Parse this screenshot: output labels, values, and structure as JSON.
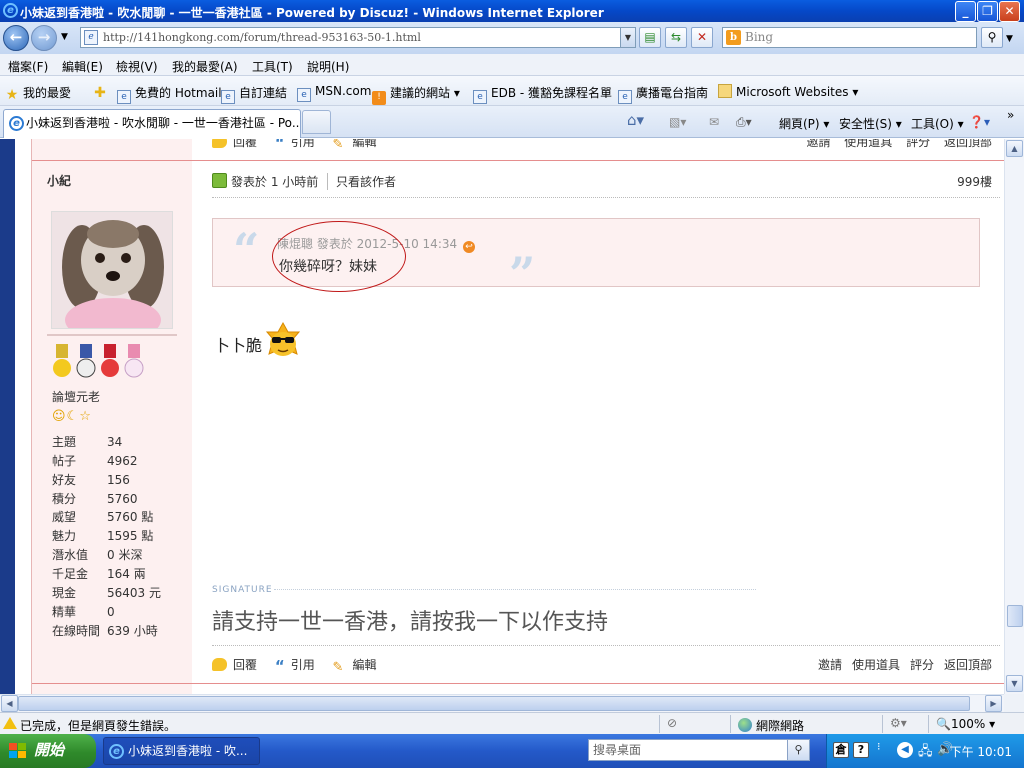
{
  "window": {
    "title": "小妹返到香港啦 - 吹水閒聊 - 一世一香港社區 - Powered by Discuz! - Windows Internet Explorer",
    "minimize": "_",
    "restore": "❐",
    "close": "✕"
  },
  "address": {
    "url": "http://141hongkong.com/forum/thread-953163-50-1.html",
    "search_placeholder": "Bing"
  },
  "menu": [
    "檔案(F)",
    "編輯(E)",
    "檢視(V)",
    "我的最愛(A)",
    "工具(T)",
    "說明(H)"
  ],
  "favorites": {
    "label": "我的最愛",
    "items": [
      "免費的 Hotmail",
      "自訂連結",
      "MSN.com",
      "建議的網站 ▾",
      "EDB - 獲豁免課程名單",
      "廣播電台指南",
      "Microsoft Websites ▾"
    ]
  },
  "tab": {
    "title": "小妹返到香港啦 - 吹水閒聊 - 一世一香港社區 - Po..."
  },
  "commands": {
    "page": "網頁(P) ▾",
    "safety": "安全性(S) ▾",
    "tools": "工具(O) ▾"
  },
  "prev_post_actions": {
    "reply": "回覆",
    "quote": "引用",
    "edit": "編輯",
    "invite": "邀請",
    "use_item": "使用道具",
    "rate": "評分",
    "top": "返回頂部"
  },
  "user": {
    "name": "小紀",
    "rank": "論壇元老",
    "rank_icons": "☺☾☆",
    "stats": [
      {
        "k": "主題",
        "v": "34"
      },
      {
        "k": "帖子",
        "v": "4962"
      },
      {
        "k": "好友",
        "v": "156"
      },
      {
        "k": "積分",
        "v": "5760"
      },
      {
        "k": "威望",
        "v": "5760 點"
      },
      {
        "k": "魅力",
        "v": "1595 點"
      },
      {
        "k": "潛水值",
        "v": "0 米深"
      },
      {
        "k": "千足金",
        "v": "164 兩"
      },
      {
        "k": "現金",
        "v": "56403 元"
      },
      {
        "k": "精華",
        "v": "0"
      },
      {
        "k": "在線時間",
        "v": "639 小時"
      }
    ]
  },
  "post": {
    "posted": "發表於 1 小時前",
    "view_author": "只看該作者",
    "floor": "999樓",
    "quote_meta": "陳焜聰 發表於 2012-5-10 14:34",
    "quote_text": "你幾碎呀？妹妹",
    "body": "卜卜脆",
    "signature_label": "SIGNATURE",
    "signature": "請支持一世一香港，請按我一下以作支持"
  },
  "post_actions": {
    "reply": "回覆",
    "quote": "引用",
    "edit": "編輯",
    "invite": "邀請",
    "use_item": "使用道具",
    "rate": "評分",
    "top": "返回頂部"
  },
  "status": {
    "text": "已完成，但是網頁發生錯誤。",
    "zone": "網際網路",
    "zoom": "🔍100%  ▾"
  },
  "taskbar": {
    "start": "開始",
    "app": "小妹返到香港啦 - 吹...",
    "search_placeholder": "搜尋桌面",
    "clock": "下午 10:01"
  }
}
